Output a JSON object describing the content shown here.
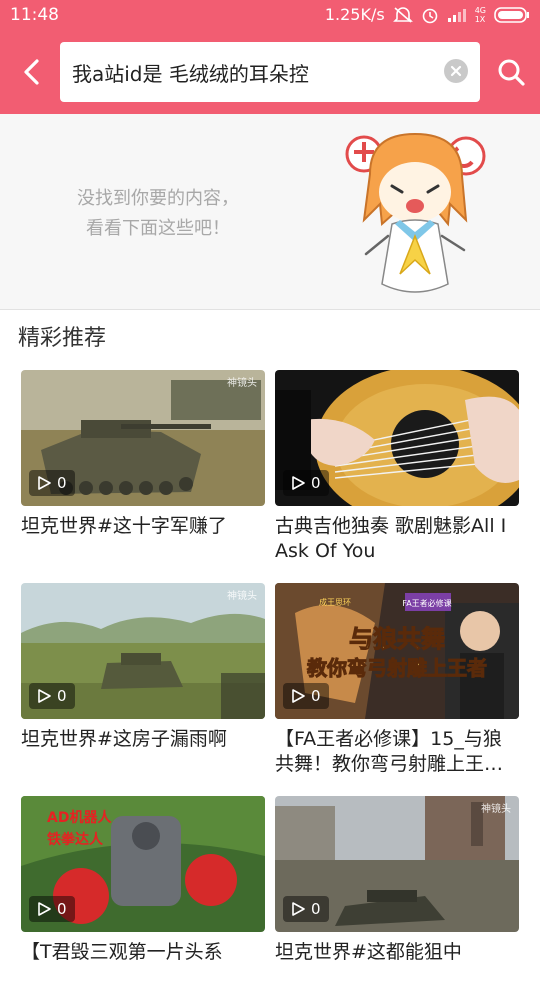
{
  "status_bar": {
    "time": "11:48",
    "speed": "1.25K/s",
    "net_top": "4G",
    "net_bottom": "1X"
  },
  "search": {
    "query": "我a站id是 毛绒绒的耳朵控"
  },
  "empty_state": {
    "line1": "没找到你要的内容，",
    "line2": "看看下面这些吧！"
  },
  "recommend": {
    "title": "精彩推荐",
    "watermark": "神镜头",
    "items": [
      {
        "title": "坦克世界#这十字军赚了",
        "plays": "0"
      },
      {
        "title": "古典吉他独奏 歌剧魅影All I Ask Of You",
        "plays": "0"
      },
      {
        "title": "坦克世界#这房子漏雨啊",
        "plays": "0"
      },
      {
        "title": "【FA王者必修课】15_与狼共舞！教你弯弓射雕上王…",
        "plays": "0",
        "thumb_text1": "与狼共舞",
        "thumb_text2": "教你弯弓射雕上王者",
        "thumb_badge1": "成王思环",
        "thumb_badge2": "FA王者必修课"
      },
      {
        "title": "【T君毁三观第一片头系",
        "plays": "0",
        "thumb_text1": "AD机器人",
        "thumb_text2": "铁拳达人"
      },
      {
        "title": "坦克世界#这都能狙中",
        "plays": "0"
      }
    ]
  },
  "colors": {
    "brand": "#f25d72",
    "empty_bg": "#f7f7f7",
    "hint": "#a8a8a8"
  }
}
